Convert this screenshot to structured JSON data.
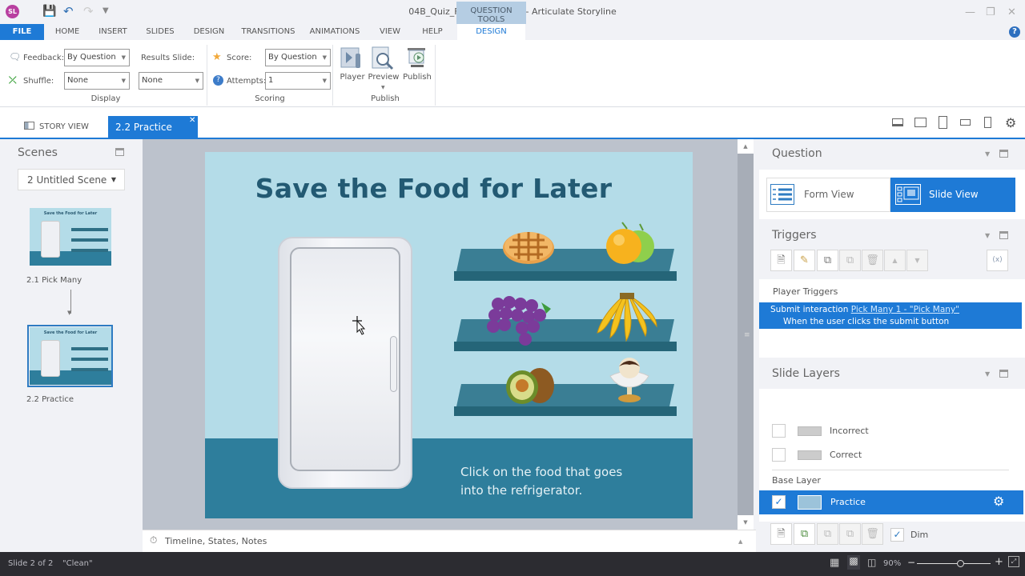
{
  "app": {
    "logo_text": "SL",
    "window_title": "04B_Quiz_Freeform.story* - Articulate Storyline",
    "context_tab_group": "QUESTION TOOLS"
  },
  "menu_tabs": [
    "FILE",
    "HOME",
    "INSERT",
    "SLIDES",
    "DESIGN",
    "TRANSITIONS",
    "ANIMATIONS",
    "VIEW",
    "HELP"
  ],
  "context_tab": "DESIGN",
  "ribbon": {
    "display": {
      "group_label": "Display",
      "feedback_label": "Feedback:",
      "feedback_value": "By Question",
      "shuffle_label": "Shuffle:",
      "shuffle_value": "None",
      "results_slide_label": "Results Slide:",
      "results_slide_value": "None"
    },
    "scoring": {
      "group_label": "Scoring",
      "score_label": "Score:",
      "score_value": "By Question",
      "attempts_label": "Attempts:",
      "attempts_value": "1"
    },
    "publish": {
      "group_label": "Publish",
      "player_label": "Player",
      "preview_label": "Preview",
      "publish_label": "Publish"
    }
  },
  "doc_tabs": {
    "story_view": "STORY VIEW",
    "active_tab": "2.2 Practice"
  },
  "scenes": {
    "title": "Scenes",
    "scene_selected": "2 Untitled Scene",
    "slides": [
      {
        "label": "2.1 Pick Many",
        "thumb_title": "Save the Food for Later"
      },
      {
        "label": "2.2 Practice",
        "thumb_title": "Save the Food for Later"
      }
    ]
  },
  "slide": {
    "title": "Save the Food for Later",
    "instruction_line1": "Click on the food that goes",
    "instruction_line2": "into the refrigerator.",
    "foods": [
      "pie",
      "melons",
      "grapes",
      "bananas",
      "avocado-kiwi",
      "ice-cream-sundae"
    ],
    "colors": {
      "background": "#b4dce8",
      "floor": "#2e7e9c",
      "title": "#235a73",
      "shelf": "#3a7e94"
    }
  },
  "timeline_bar": {
    "label": "Timeline, States, Notes"
  },
  "question_panel": {
    "title": "Question",
    "form_view": "Form View",
    "slide_view": "Slide View"
  },
  "triggers_panel": {
    "title": "Triggers",
    "section": "Player Triggers",
    "trigger": {
      "action": "Submit interaction",
      "target": "Pick Many 1 - \"Pick Many\"",
      "condition": "When the user clicks the submit button"
    }
  },
  "layers_panel": {
    "title": "Slide Layers",
    "layers": [
      {
        "name": "Incorrect",
        "checked": false
      },
      {
        "name": "Correct",
        "checked": false
      }
    ],
    "base_layer_label": "Base Layer",
    "base_layer": {
      "name": "Practice",
      "checked": true
    },
    "dim_label": "Dim",
    "dim_checked": true
  },
  "status": {
    "slide_info": "Slide 2 of 2",
    "theme": "\"Clean\"",
    "zoom": "90%",
    "zoom_percent": 90
  },
  "colors": {
    "accent": "#1e7ad6",
    "status_bar": "#2c2c31"
  }
}
